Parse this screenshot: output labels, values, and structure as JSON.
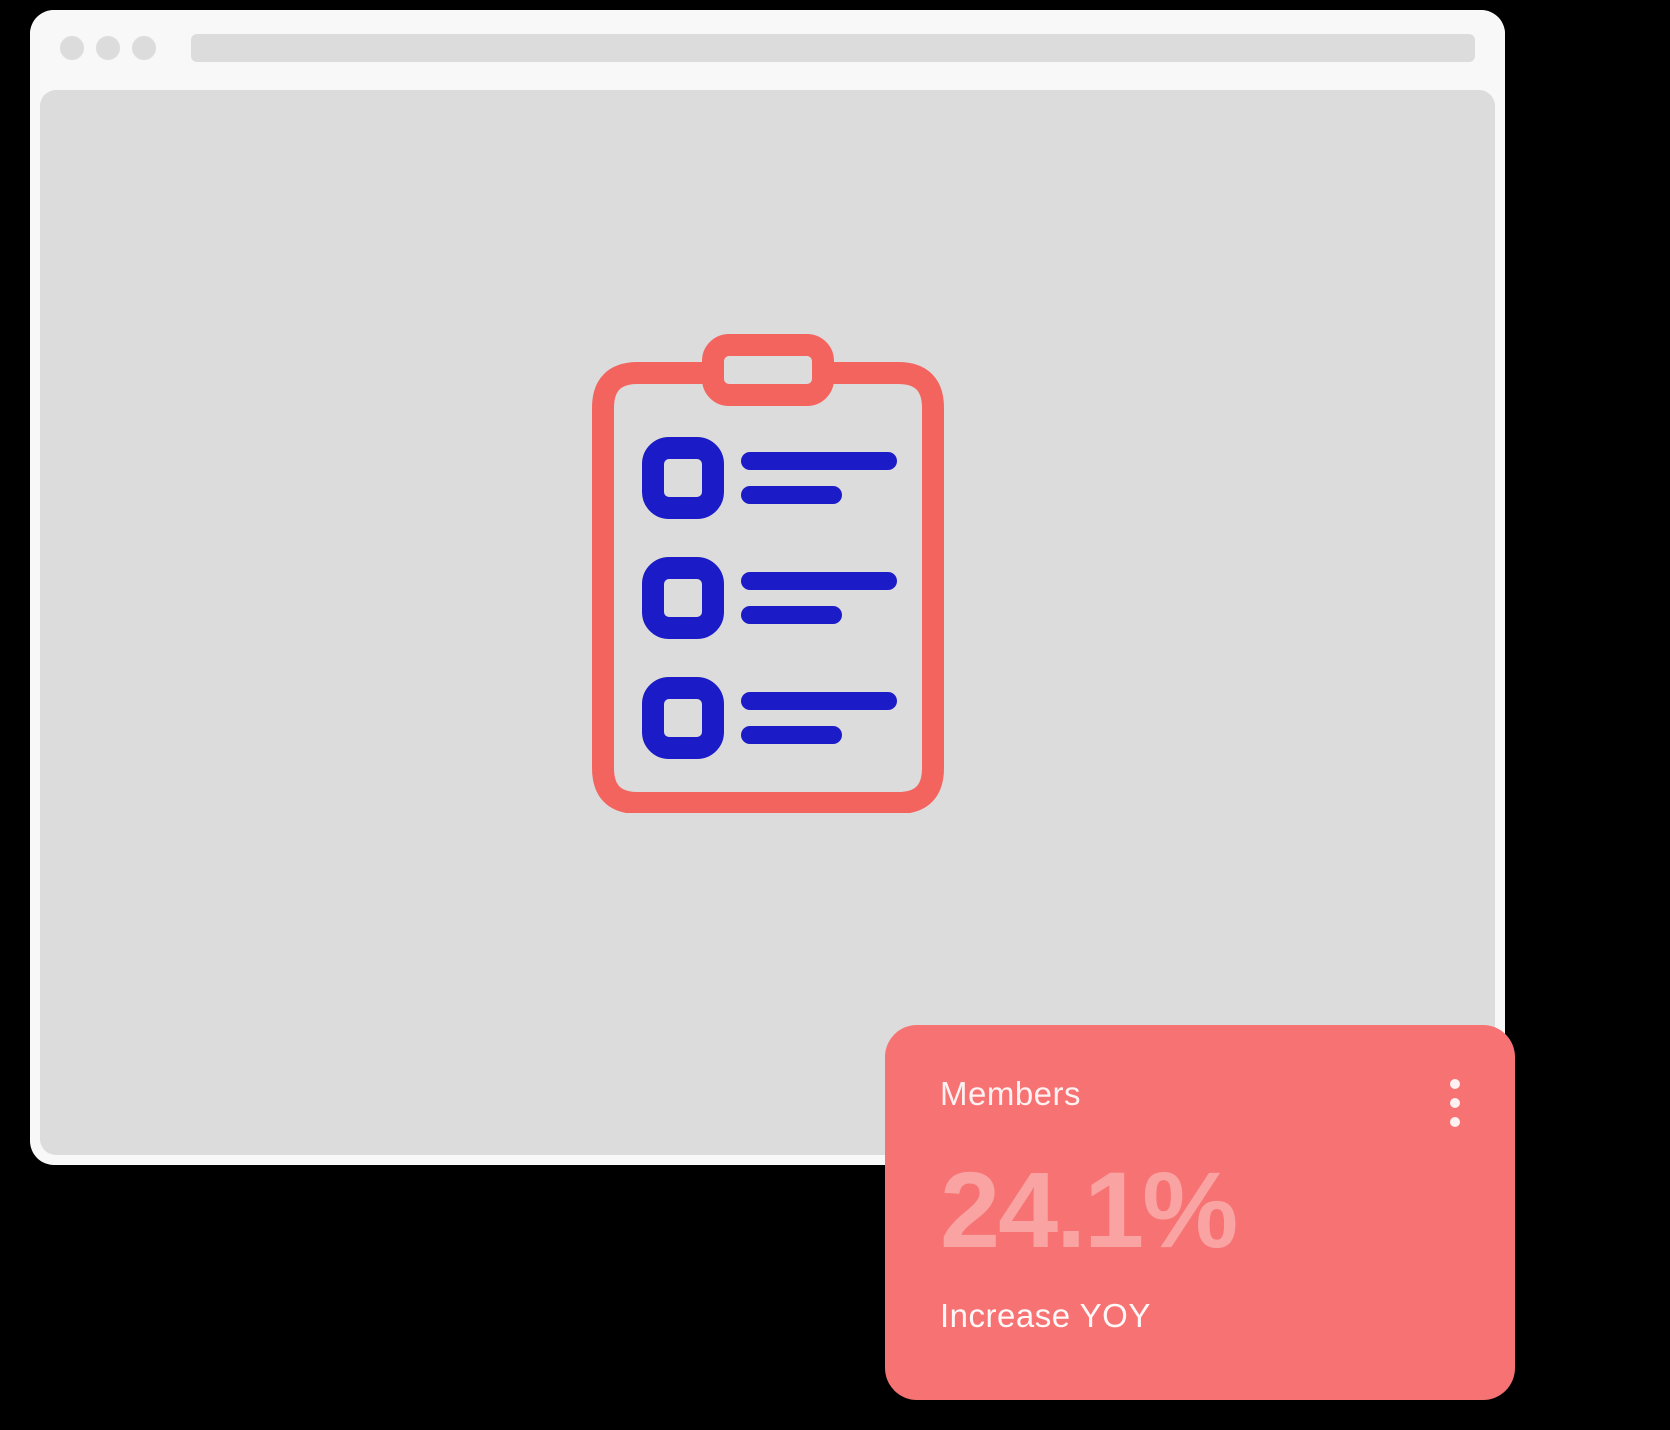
{
  "icons": {
    "clipboard": "clipboard-checklist-icon",
    "menu": "vertical-dots-icon"
  },
  "colors": {
    "accent_coral": "#f4645f",
    "accent_blue": "#1b1bc7",
    "card_bg": "#f77272",
    "frame_bg": "#f8f8f8",
    "content_bg": "#dcdcdc"
  },
  "metric_card": {
    "title": "Members",
    "value": "24.1%",
    "subtitle": "Increase YOY"
  }
}
